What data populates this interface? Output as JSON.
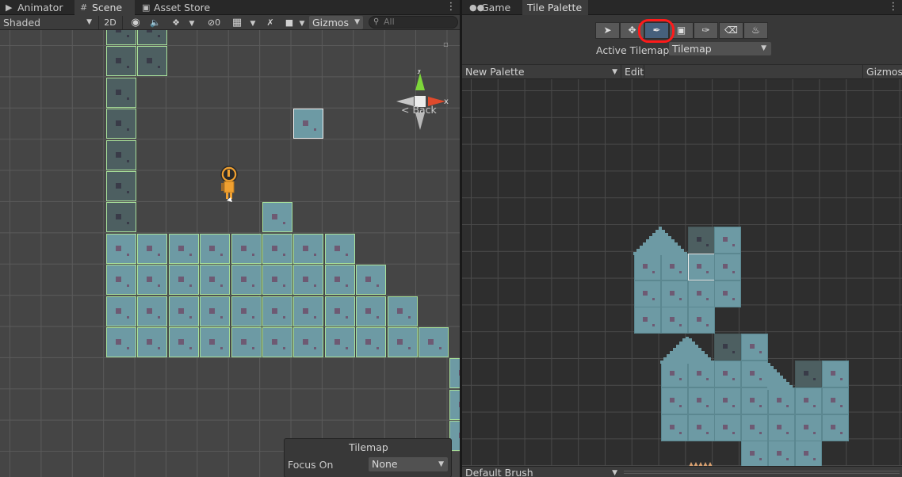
{
  "left_panel": {
    "tabs": [
      {
        "label": "Animator",
        "icon": "animator-icon"
      },
      {
        "label": "Scene",
        "icon": "scene-grid-icon"
      },
      {
        "label": "Asset Store",
        "icon": "asset-store-icon"
      }
    ],
    "toolbar": {
      "shading_mode": "Shaded",
      "toggle_2d": "2D",
      "hidden_count": "0",
      "gizmos": "Gizmos",
      "search_placeholder": "All"
    },
    "gizmo": {
      "x_label": "x",
      "y_label": "y",
      "back_label": "< Back"
    },
    "tilemap_overlay": {
      "title": "Tilemap",
      "focus_label": "Focus On",
      "focus_value": "None"
    }
  },
  "right_panel": {
    "tabs": [
      {
        "label": "Game",
        "icon": "gamepad-icon"
      },
      {
        "label": "Tile Palette",
        "icon": ""
      }
    ],
    "tools": [
      {
        "name": "select-tool",
        "icon": "arrow-icon"
      },
      {
        "name": "move-tool",
        "icon": "move-icon"
      },
      {
        "name": "paint-brush-tool",
        "icon": "brush-icon"
      },
      {
        "name": "box-fill-tool",
        "icon": "box-fill-icon"
      },
      {
        "name": "picker-tool",
        "icon": "eyedropper-icon"
      },
      {
        "name": "eraser-tool",
        "icon": "eraser-icon"
      },
      {
        "name": "fill-tool",
        "icon": "paint-bucket-icon"
      }
    ],
    "active_tool": "paint-brush-tool",
    "highlight_color": "#ff1a1a",
    "active_tilemap_label": "Active Tilemap",
    "active_tilemap_value": "Tilemap",
    "palette_name": "New Palette",
    "edit_label": "Edit",
    "gizmos_label": "Gizmos",
    "brush_name": "Default Brush"
  },
  "colors": {
    "tile": "#6d9aa4",
    "tile_border": "#a7e09a",
    "tile_dark": "#4d5f61",
    "tile_dot": "#6e5a73"
  }
}
